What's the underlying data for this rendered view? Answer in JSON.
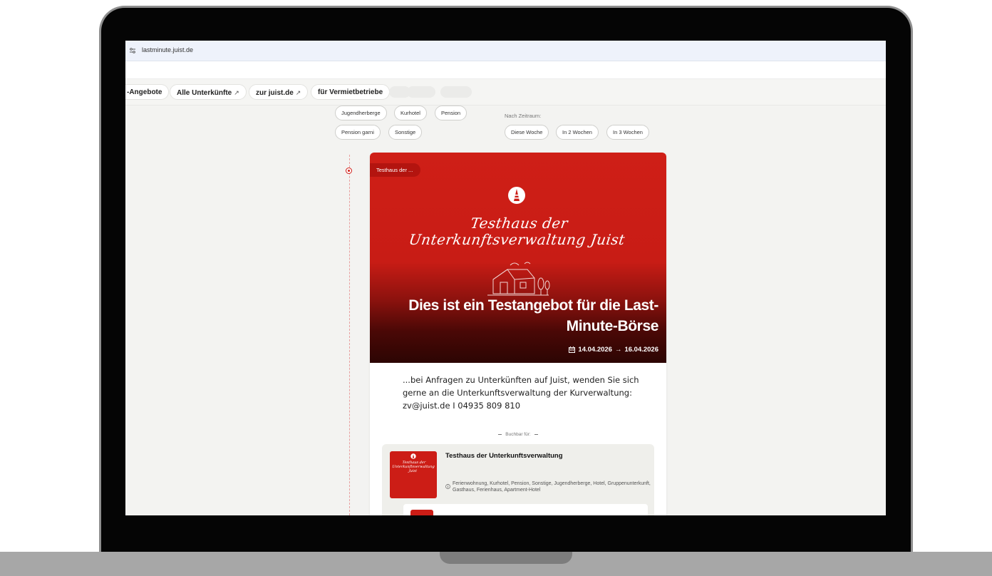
{
  "browser": {
    "url": "lastminute.juist.de"
  },
  "nav": {
    "items": [
      "-Angebote",
      "Alle Unterkünfte",
      "zur juist.de",
      "für Vermietbetriebe"
    ],
    "external_marker": "↗"
  },
  "filters": {
    "type_chips": [
      "Jugendherberge",
      "Kurhotel",
      "Pension",
      "Pension garni",
      "Sonstige"
    ],
    "time_label": "Nach Zeitraum:",
    "time_chips": [
      "Diese Woche",
      "In 2 Wochen",
      "In 3 Wochen"
    ]
  },
  "offer": {
    "badge": "Testhaus der ...",
    "script_line1": "Testhaus der",
    "script_line2": "Unterkunftsverwaltung Juist",
    "title_line1": "Dies ist ein Testangebot für die Last-",
    "title_line2": "Minute-Börse",
    "date_from": "14.04.2026",
    "date_arrow": "→",
    "date_to": "16.04.2026",
    "description": "...bei Anfragen zu Unterkünften auf Juist, wenden Sie sich gerne an die Unterkunftsverwaltung der Kurverwaltung: zv@juist.de I 04935 809 810",
    "bookable_label": "Buchbar für:"
  },
  "host": {
    "name": "Testhaus der Unterkunftsverwaltung",
    "thumb_script_line1": "Testhaus der",
    "thumb_script_line2": "Unterkunftsverwaltung Juist",
    "types": "Ferienwohnung, Kurhotel, Pension, Sonstige, Jugendherberge, Hotel, Gruppenunterkunft, Gasthaus, Ferienhaus, Apartment-Hotel"
  },
  "colors": {
    "brand_red": "#cc1d16",
    "page_bg": "#f3f3f1"
  }
}
